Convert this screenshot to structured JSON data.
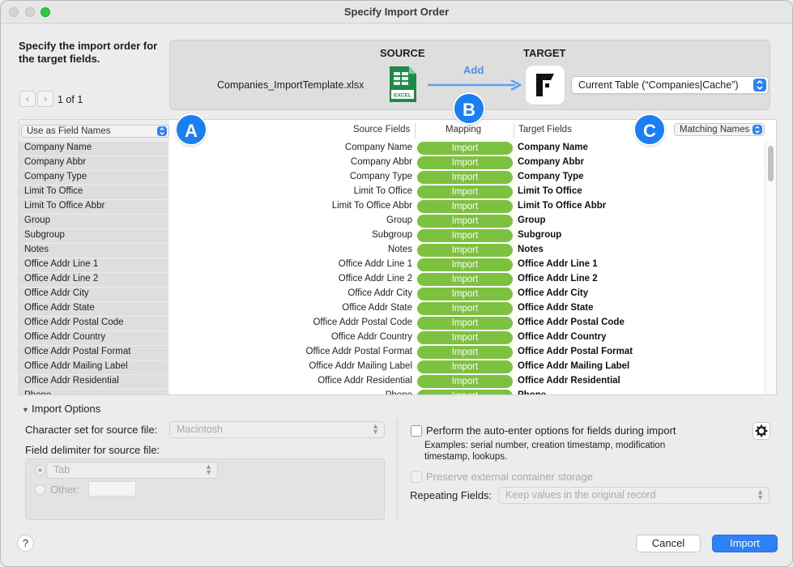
{
  "window": {
    "title": "Specify Import Order"
  },
  "heading": "Specify the import order for the target fields.",
  "pager": {
    "prev": "‹",
    "next": "›",
    "text": "1 of 1"
  },
  "source": {
    "title": "SOURCE",
    "file_name": "Companies_ImportTemplate.xlsx",
    "icon": "excel-file-icon",
    "icon_label": "EXCEL"
  },
  "target": {
    "title": "TARGET",
    "icon": "filemaker-logo-icon",
    "table_select": "Current Table (“Companies|Cache”)"
  },
  "add_label": "Add",
  "badges": {
    "a": "A",
    "b": "B",
    "c": "C"
  },
  "table": {
    "use_as_select": "Use as Field Names",
    "col_source": "Source Fields",
    "col_mapping": "Mapping",
    "col_target": "Target Fields",
    "matching_select": "Matching Names",
    "rows": [
      {
        "left": "Company Name",
        "source": "Company Name",
        "mapping": "Import",
        "target": "Company Name"
      },
      {
        "left": "Company Abbr",
        "source": "Company Abbr",
        "mapping": "Import",
        "target": "Company Abbr"
      },
      {
        "left": "Company Type",
        "source": "Company Type",
        "mapping": "Import",
        "target": "Company Type"
      },
      {
        "left": "Limit To Office",
        "source": "Limit To Office",
        "mapping": "Import",
        "target": "Limit To Office"
      },
      {
        "left": "Limit To Office Abbr",
        "source": "Limit To Office Abbr",
        "mapping": "Import",
        "target": "Limit To Office Abbr"
      },
      {
        "left": "Group",
        "source": "Group",
        "mapping": "Import",
        "target": "Group"
      },
      {
        "left": "Subgroup",
        "source": "Subgroup",
        "mapping": "Import",
        "target": "Subgroup"
      },
      {
        "left": "Notes",
        "source": "Notes",
        "mapping": "Import",
        "target": "Notes"
      },
      {
        "left": "Office Addr Line 1",
        "source": "Office Addr Line 1",
        "mapping": "Import",
        "target": "Office Addr Line 1"
      },
      {
        "left": "Office Addr Line 2",
        "source": "Office Addr Line 2",
        "mapping": "Import",
        "target": "Office Addr Line 2"
      },
      {
        "left": "Office Addr City",
        "source": "Office Addr City",
        "mapping": "Import",
        "target": "Office Addr City"
      },
      {
        "left": "Office Addr State",
        "source": "Office Addr State",
        "mapping": "Import",
        "target": "Office Addr State"
      },
      {
        "left": "Office Addr Postal Code",
        "source": "Office Addr Postal Code",
        "mapping": "Import",
        "target": "Office Addr Postal Code"
      },
      {
        "left": "Office Addr Country",
        "source": "Office Addr Country",
        "mapping": "Import",
        "target": "Office Addr Country"
      },
      {
        "left": "Office Addr Postal Format",
        "source": "Office Addr Postal Format",
        "mapping": "Import",
        "target": "Office Addr Postal Format"
      },
      {
        "left": "Office Addr Mailing Label",
        "source": "Office Addr Mailing Label",
        "mapping": "Import",
        "target": "Office Addr Mailing Label"
      },
      {
        "left": "Office Addr Residential",
        "source": "Office Addr Residential",
        "mapping": "Import",
        "target": "Office Addr Residential"
      },
      {
        "left": "Phone",
        "source": "Phone",
        "mapping": "Import",
        "target": "Phone"
      }
    ]
  },
  "options": {
    "section_title": "Import Options",
    "charset_label": "Character set for source file:",
    "charset_value": "Macintosh",
    "delimiter_label": "Field delimiter for source file:",
    "delim_tab": "Tab",
    "delim_other": "Other:",
    "auto_enter_label": "Perform the auto-enter options for fields during import",
    "auto_enter_examples": "Examples: serial number, creation timestamp, modification timestamp, lookups.",
    "preserve_label": "Preserve external container storage",
    "repeating_label": "Repeating Fields:",
    "repeating_value": "Keep values in the original record"
  },
  "buttons": {
    "help": "?",
    "cancel": "Cancel",
    "import": "Import"
  },
  "colors": {
    "accent": "#2f7ff6",
    "import_pill": "#7cc13f",
    "badge": "#1a7ff3"
  }
}
